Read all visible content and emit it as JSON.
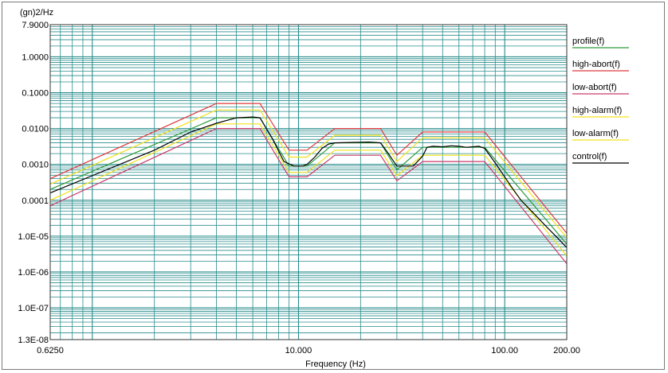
{
  "chart_data": {
    "type": "line",
    "title": "",
    "ylabel": "(gn)2/Hz",
    "xlabel": "Frequency (Hz)",
    "x_scale": "log",
    "y_scale": "log",
    "xlim": [
      0.625,
      200
    ],
    "ylim": [
      1.3e-08,
      7.9
    ],
    "grid": true,
    "legend_placement": "right",
    "x_tick_labels": [
      {
        "value": 0.625,
        "label": "0.6250"
      },
      {
        "value": 10,
        "label": "10.000"
      },
      {
        "value": 100,
        "label": "100.00"
      },
      {
        "value": 200,
        "label": "200.00"
      }
    ],
    "y_tick_labels": [
      {
        "value": 7.9,
        "label": "7.9000"
      },
      {
        "value": 1,
        "label": "1.0000"
      },
      {
        "value": 0.1,
        "label": "0.1000"
      },
      {
        "value": 0.01,
        "label": "0.0100"
      },
      {
        "value": 0.001,
        "label": "0.0010"
      },
      {
        "value": 0.0001,
        "label": "0.0001"
      },
      {
        "value": 1e-05,
        "label": "1.0E-05"
      },
      {
        "value": 1e-06,
        "label": "1.0E-06"
      },
      {
        "value": 1e-07,
        "label": "1.0E-07"
      },
      {
        "value": 1.3e-08,
        "label": "1.3E-08"
      }
    ],
    "series": [
      {
        "name": "profile(f)",
        "color": "#2e9a3a",
        "x": [
          0.625,
          4,
          6.5,
          9,
          11,
          15,
          25,
          30,
          40,
          80,
          200
        ],
        "y": [
          0.0002,
          0.02,
          0.02,
          0.0009,
          0.0009,
          0.004,
          0.004,
          0.0007,
          0.003,
          0.003,
          6e-06
        ]
      },
      {
        "name": "high-abort(f)",
        "color": "#e0393e",
        "x": [
          0.625,
          4,
          6.5,
          9,
          11,
          15,
          25,
          30,
          40,
          80,
          200
        ],
        "y": [
          0.0004,
          0.05,
          0.05,
          0.0025,
          0.0025,
          0.01,
          0.01,
          0.0018,
          0.008,
          0.008,
          1.2e-05
        ]
      },
      {
        "name": "low-abort(f)",
        "color": "#cc3a6a",
        "x": [
          0.625,
          4,
          6.5,
          9,
          11,
          15,
          25,
          30,
          40,
          80,
          200
        ],
        "y": [
          7e-05,
          0.01,
          0.01,
          0.00045,
          0.00045,
          0.0018,
          0.0018,
          0.00035,
          0.0012,
          0.0012,
          1.7e-06
        ]
      },
      {
        "name": "high-alarm(f)",
        "color": "#f2e21a",
        "x": [
          0.625,
          4,
          6.5,
          9,
          11,
          15,
          25,
          30,
          40,
          80,
          200
        ],
        "y": [
          0.00028,
          0.033,
          0.033,
          0.0016,
          0.0016,
          0.0065,
          0.0065,
          0.0012,
          0.0055,
          0.0055,
          9e-06
        ]
      },
      {
        "name": "low-alarm(f)",
        "color": "#f2e21a",
        "x": [
          0.625,
          4,
          6.5,
          9,
          11,
          15,
          25,
          30,
          40,
          80,
          200
        ],
        "y": [
          0.0001,
          0.0135,
          0.0135,
          0.0006,
          0.0006,
          0.0025,
          0.0025,
          0.00048,
          0.0018,
          0.0018,
          2.8e-06
        ]
      },
      {
        "name": "control(f)",
        "color": "#000000",
        "x": [
          0.625,
          2,
          3,
          4,
          5,
          6,
          6.5,
          7.5,
          8.5,
          9.5,
          10.5,
          11,
          12,
          13,
          14,
          15,
          18,
          22,
          25,
          27,
          30,
          36,
          40,
          42,
          45,
          50,
          55,
          60,
          65,
          70,
          75,
          80,
          90,
          100,
          110,
          120,
          140,
          160,
          180,
          200
        ],
        "y": [
          0.00016,
          0.0025,
          0.008,
          0.014,
          0.02,
          0.021,
          0.02,
          0.005,
          0.0012,
          0.0009,
          0.0009,
          0.001,
          0.0016,
          0.0028,
          0.0037,
          0.004,
          0.0041,
          0.0042,
          0.004,
          0.0022,
          0.0009,
          0.0009,
          0.0017,
          0.003,
          0.0032,
          0.0031,
          0.0033,
          0.0032,
          0.003,
          0.0031,
          0.0032,
          0.0028,
          0.0011,
          0.00045,
          0.0002,
          0.0001,
          4e-05,
          1.8e-05,
          9e-06,
          4.8e-06
        ]
      }
    ]
  }
}
